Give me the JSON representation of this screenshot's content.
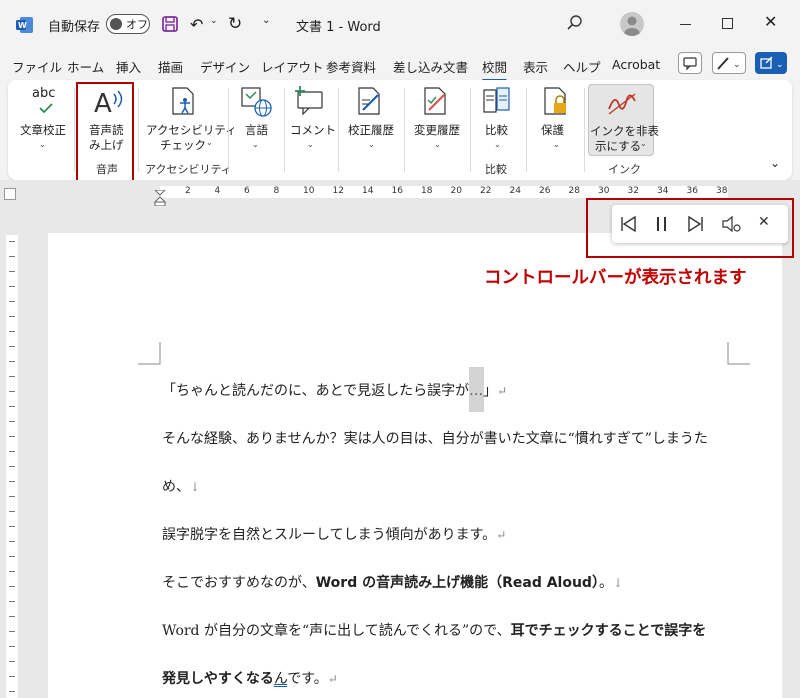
{
  "titlebar": {
    "autosave_label": "自動保存",
    "autosave_state": "オフ",
    "document_title": "文書 1  -  Word"
  },
  "tabs": [
    "ファイル",
    "ホーム",
    "挿入",
    "描画",
    "デザイン",
    "レイアウト",
    "参考資料",
    "差し込み文書",
    "校閲",
    "表示",
    "ヘルプ",
    "Acrobat"
  ],
  "active_tab": "校閲",
  "ribbon": {
    "spelling": "文章校正",
    "read_aloud_1": "音声読",
    "read_aloud_2": "み上げ",
    "group_voice": "音声",
    "accessibility_1": "アクセシビリティ",
    "accessibility_2": "チェック",
    "group_accessibility": "アクセシビリティ",
    "language": "言語",
    "comment": "コメント",
    "tracking": "校正履歴",
    "changes": "変更履歴",
    "compare": "比較",
    "group_compare": "比較",
    "protect": "保護",
    "hide_ink_1": "インクを非表",
    "hide_ink_2": "示にする",
    "group_ink": "インク"
  },
  "ruler_numbers": [
    "2",
    "4",
    "6",
    "8",
    "10",
    "12",
    "14",
    "16",
    "18",
    "20",
    "22",
    "24",
    "26",
    "28",
    "30",
    "32",
    "34",
    "36",
    "38"
  ],
  "callout": "コントロールバーが表示されます",
  "document": {
    "line1": "「ちゃんと読んだのに、あとで見返したら誤字が…」",
    "line2": "そんな経験、ありませんか？実は人の目は、自分が書いた文章に“慣れすぎて”しまうた",
    "line3": "め、",
    "line4": "誤字脱字を自然とスルーしてしまう傾向があります。",
    "line5a": "そこでおすすめなのが、",
    "line5b": "Word の音声読み上げ機能（Read Aloud）",
    "line5c": "。",
    "line6a": "Word が自分の文章を“声に出して読んでくれる”ので、",
    "line6b": "耳でチェックすることで誤字を",
    "line7a": "発見しやすくなる",
    "line7b": "ん",
    "line7c": "です。"
  },
  "colors": {
    "accent": "#1a5fb4",
    "highlight_red": "#b00000"
  }
}
